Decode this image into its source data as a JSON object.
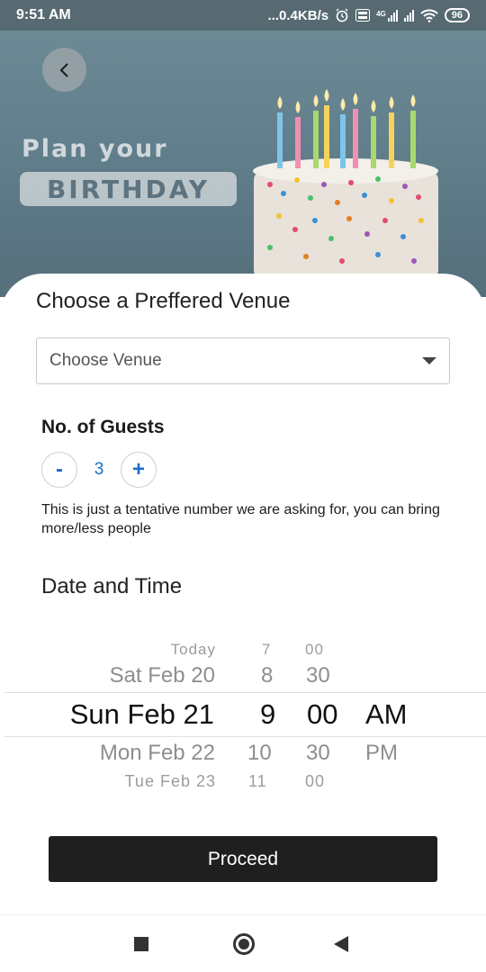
{
  "status_bar": {
    "time": "9:51 AM",
    "net_speed": "...0.4KB/s",
    "network_type": "4G",
    "battery": "96",
    "icons": [
      "alarm-icon",
      "volte-icon",
      "signal-icon",
      "signal-icon",
      "wifi-icon",
      "battery-icon"
    ]
  },
  "hero": {
    "plan_text": "Plan your",
    "birthday_text": "BIRTHDAY",
    "back_icon": "chevron-left-icon"
  },
  "venue": {
    "title": "Choose a Preffered Venue",
    "placeholder": "Choose Venue",
    "dropdown_icon": "caret-down-icon"
  },
  "guests": {
    "title": "No. of Guests",
    "minus": "-",
    "value": "3",
    "plus": "+",
    "note": "This is just a tentative number we are asking for, you can bring more/less people"
  },
  "datetime": {
    "title": "Date and Time",
    "dates": [
      "Today",
      "Sat Feb 20",
      "Sun Feb 21",
      "Mon Feb 22",
      "Tue Feb 23"
    ],
    "hours": [
      "7",
      "8",
      "9",
      "10",
      "11"
    ],
    "minutes": [
      "00",
      "30",
      "00",
      "30",
      "00"
    ],
    "ampm": [
      "AM",
      "PM"
    ]
  },
  "actions": {
    "proceed": "Proceed"
  },
  "navbar": {
    "icons": [
      "recents-square-icon",
      "home-circle-icon",
      "back-triangle-icon"
    ]
  },
  "colors": {
    "accent": "#1e6fc8",
    "button_bg": "#1f1f1f",
    "hero_bg": "#62808d"
  }
}
